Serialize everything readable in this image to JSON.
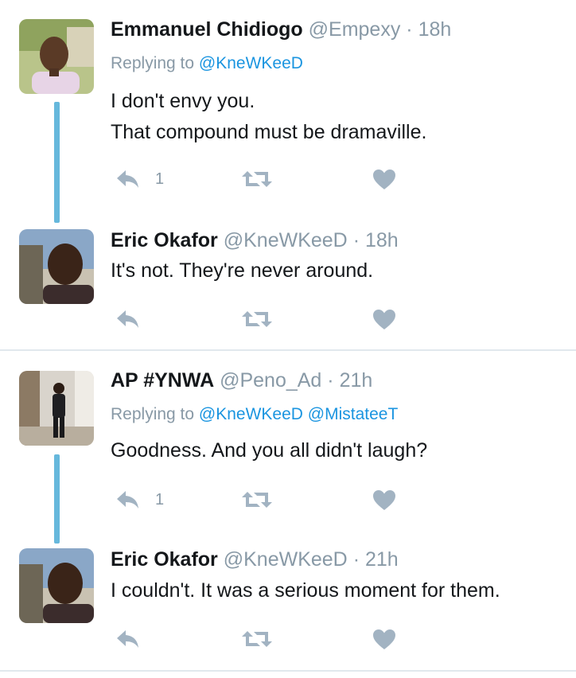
{
  "colors": {
    "accent": "#1b95e0",
    "thread_line": "#66b8dc",
    "muted": "#8899a6",
    "icon": "#a2b3c2",
    "divider": "#e1e8ed"
  },
  "tweets": [
    {
      "name": "Emmanuel Chidiogo",
      "handle": "@Empexy",
      "sep": "·",
      "time": "18h",
      "replying_prefix": "Replying to",
      "replying_to": [
        "@KneWKeeD"
      ],
      "text_lines": [
        "I don't envy you.",
        "That compound must be dramaville."
      ],
      "reply_count": "1",
      "icons": {
        "reply": "reply-icon",
        "retweet": "retweet-icon",
        "like": "heart-icon"
      }
    },
    {
      "name": "Eric Okafor",
      "handle": "@KneWKeeD",
      "sep": "·",
      "time": "18h",
      "text_lines": [
        "It's not. They're never around."
      ]
    },
    {
      "name": "AP #YNWA",
      "handle": "@Peno_Ad",
      "sep": "·",
      "time": "21h",
      "replying_prefix": "Replying to",
      "replying_to": [
        "@KneWKeeD",
        "@MistateeT"
      ],
      "text_lines": [
        "Goodness. And you all didn't laugh?"
      ],
      "reply_count": "1"
    },
    {
      "name": "Eric Okafor",
      "handle": "@KneWKeeD",
      "sep": "·",
      "time": "21h",
      "text_lines": [
        "I couldn't. It was a serious moment for them."
      ]
    }
  ]
}
